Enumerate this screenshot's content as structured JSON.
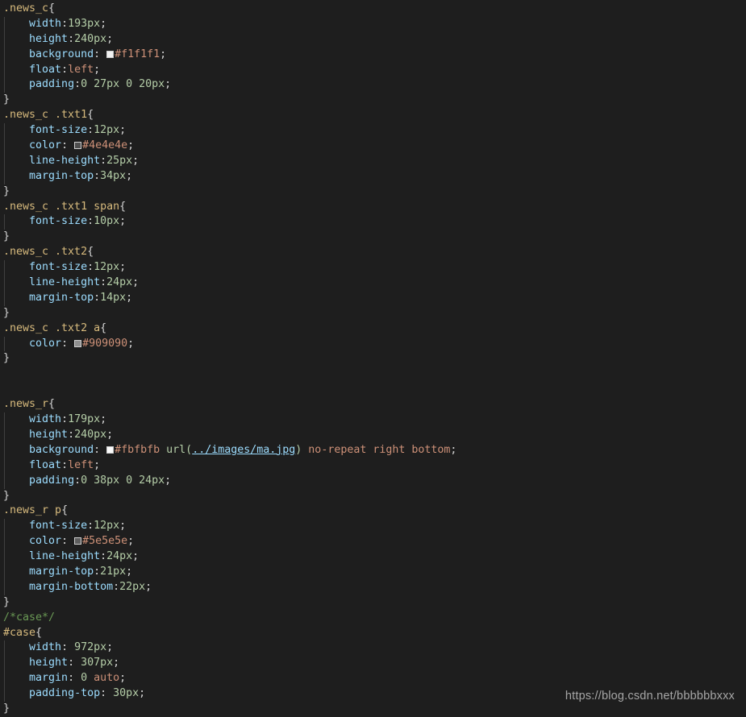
{
  "editor": {
    "background_color": "#1e1e1e",
    "language": "css",
    "indent_guide_color": "#404040"
  },
  "theme": {
    "selector_color": "#d7ba7d",
    "property_color": "#9cdcfe",
    "number_color": "#b5cea8",
    "keyword_color": "#ce9178",
    "comment_color": "#6a9955",
    "punctuation_color": "#d4d4d4",
    "link_color": "#9cdcfe"
  },
  "code": {
    "l1_selector": ".news_c",
    "l1_brace": "{",
    "l2_prop": "width",
    "l2_colon": ":",
    "l2_val": "193px",
    "l2_semi": ";",
    "l3_prop": "height",
    "l3_colon": ":",
    "l3_val": "240px",
    "l3_semi": ";",
    "l4_prop": "background",
    "l4_colon": ": ",
    "l4_swatch": "#f1f1f1",
    "l4_val": "#f1f1f1",
    "l4_semi": ";",
    "l5_prop": "float",
    "l5_colon": ":",
    "l5_val": "left",
    "l5_semi": ";",
    "l6_prop": "padding",
    "l6_colon": ":",
    "l6_val": "0 27px 0 20px",
    "l6_semi": ";",
    "l7_close": "}",
    "l8_selector": ".news_c .txt1",
    "l8_brace": "{",
    "l9_prop": "font-size",
    "l9_colon": ":",
    "l9_val": "12px",
    "l9_semi": ";",
    "l10_prop": "color",
    "l10_colon": ": ",
    "l10_swatch": "#4e4e4e",
    "l10_val": "#4e4e4e",
    "l10_semi": ";",
    "l11_prop": "line-height",
    "l11_colon": ":",
    "l11_val": "25px",
    "l11_semi": ";",
    "l12_prop": "margin-top",
    "l12_colon": ":",
    "l12_val": "34px",
    "l12_semi": ";",
    "l13_close": "}",
    "l14_selector": ".news_c .txt1 span",
    "l14_brace": "{",
    "l15_prop": "font-size",
    "l15_colon": ":",
    "l15_val": "10px",
    "l15_semi": ";",
    "l16_close": "}",
    "l17_selector": ".news_c .txt2",
    "l17_brace": "{",
    "l18_prop": "font-size",
    "l18_colon": ":",
    "l18_val": "12px",
    "l18_semi": ";",
    "l19_prop": "line-height",
    "l19_colon": ":",
    "l19_val": "24px",
    "l19_semi": ";",
    "l20_prop": "margin-top",
    "l20_colon": ":",
    "l20_val": "14px",
    "l20_semi": ";",
    "l21_close": "}",
    "l22_selector": ".news_c .txt2 a",
    "l22_brace": "{",
    "l23_prop": "color",
    "l23_colon": ": ",
    "l23_swatch": "#909090",
    "l23_val": "#909090",
    "l23_semi": ";",
    "l24_close": "}",
    "l27_selector": ".news_r",
    "l27_brace": "{",
    "l28_prop": "width",
    "l28_colon": ":",
    "l28_val": "179px",
    "l28_semi": ";",
    "l29_prop": "height",
    "l29_colon": ":",
    "l29_val": "240px",
    "l29_semi": ";",
    "l30_prop": "background",
    "l30_colon": ": ",
    "l30_swatch": "#fbfbfb",
    "l30_hex": "#fbfbfb",
    "l30_fn_open": " url(",
    "l30_link": "../images/ma.jpg",
    "l30_fn_close": ")",
    "l30_kw": " no-repeat right bottom",
    "l30_semi": ";",
    "l31_prop": "float",
    "l31_colon": ":",
    "l31_val": "left",
    "l31_semi": ";",
    "l32_prop": "padding",
    "l32_colon": ":",
    "l32_val": "0 38px 0 24px",
    "l32_semi": ";",
    "l33_close": "}",
    "l34_selector": ".news_r p",
    "l34_brace": "{",
    "l35_prop": "font-size",
    "l35_colon": ":",
    "l35_val": "12px",
    "l35_semi": ";",
    "l36_prop": "color",
    "l36_colon": ": ",
    "l36_swatch": "#5e5e5e",
    "l36_val": "#5e5e5e",
    "l36_semi": ";",
    "l37_prop": "line-height",
    "l37_colon": ":",
    "l37_val": "24px",
    "l37_semi": ";",
    "l38_prop": "margin-top",
    "l38_colon": ":",
    "l38_val": "21px",
    "l38_semi": ";",
    "l39_prop": "margin-bottom",
    "l39_colon": ":",
    "l39_val": "22px",
    "l39_semi": ";",
    "l40_close": "}",
    "l41_comment": "/*case*/",
    "l42_selector": "#case",
    "l42_brace": "{",
    "l43_prop": "width",
    "l43_colon": ": ",
    "l43_val": "972px",
    "l43_semi": ";",
    "l44_prop": "height",
    "l44_colon": ": ",
    "l44_val": "307px",
    "l44_semi": ";",
    "l45_prop": "margin",
    "l45_colon": ": ",
    "l45_val0": "0",
    "l45_val1": " auto",
    "l45_semi": ";",
    "l46_prop": "padding-top",
    "l46_colon": ": ",
    "l46_val": "30px",
    "l46_semi": ";",
    "l47_close": "}"
  },
  "watermark": {
    "text": "https://blog.csdn.net/bbbbbbxxx"
  }
}
